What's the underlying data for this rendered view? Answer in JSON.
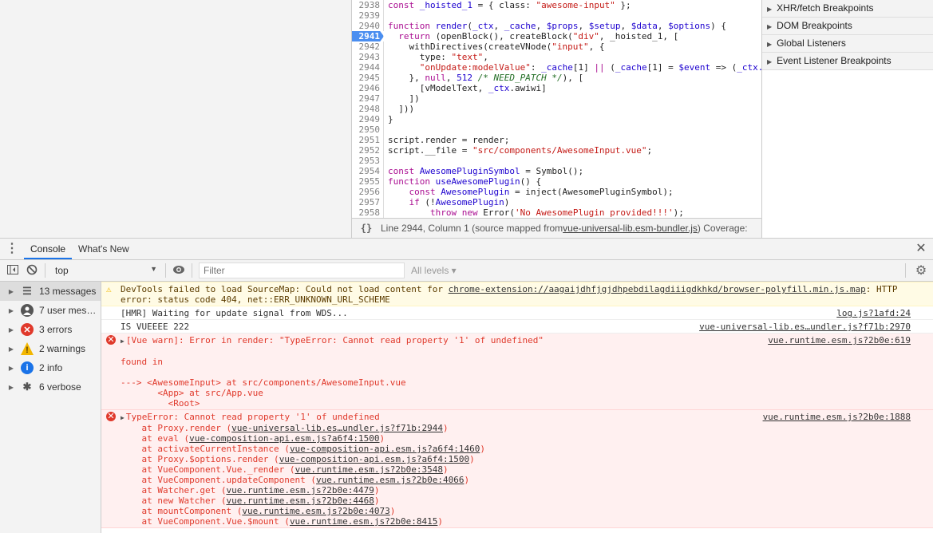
{
  "editor": {
    "active_line": "2941",
    "lines": [
      {
        "n": "2938",
        "t": [
          [
            "const ",
            "kw"
          ],
          [
            "_hoisted_1",
            "id"
          ],
          [
            " = { class: ",
            "pl"
          ],
          [
            "\"awesome-input\"",
            "st"
          ],
          [
            " };",
            "pl"
          ]
        ]
      },
      {
        "n": "2939",
        "t": []
      },
      {
        "n": "2940",
        "t": [
          [
            "function ",
            "kw"
          ],
          [
            "render",
            "id"
          ],
          [
            "(",
            "pl"
          ],
          [
            "_ctx",
            "id"
          ],
          [
            ", ",
            "pl"
          ],
          [
            "_cache",
            "id"
          ],
          [
            ", ",
            "pl"
          ],
          [
            "$props",
            "id"
          ],
          [
            ", ",
            "pl"
          ],
          [
            "$setup",
            "id"
          ],
          [
            ", ",
            "pl"
          ],
          [
            "$data",
            "id"
          ],
          [
            ", ",
            "pl"
          ],
          [
            "$options",
            "id"
          ],
          [
            ") {",
            "pl"
          ]
        ]
      },
      {
        "n": "2941",
        "t": [
          [
            "  return ",
            "kw"
          ],
          [
            "(openBlock(), createBlock(",
            "pl"
          ],
          [
            "\"div\"",
            "st"
          ],
          [
            ", _hoisted_1, [",
            "pl"
          ]
        ]
      },
      {
        "n": "2942",
        "t": [
          [
            "    withDirectives(createVNode(",
            "pl"
          ],
          [
            "\"input\"",
            "st"
          ],
          [
            ", {",
            "pl"
          ]
        ]
      },
      {
        "n": "2943",
        "t": [
          [
            "      type: ",
            "pl"
          ],
          [
            "\"text\"",
            "st"
          ],
          [
            ",",
            "pl"
          ]
        ]
      },
      {
        "n": "2944",
        "t": [
          [
            "      ",
            "pl"
          ],
          [
            "\"onUpdate:modelValue\"",
            "st"
          ],
          [
            ": ",
            "pl"
          ],
          [
            "_cache",
            "id"
          ],
          [
            "[1] ",
            "pl"
          ],
          [
            "||",
            "kw"
          ],
          [
            " (",
            "pl"
          ],
          [
            "_cache",
            "id"
          ],
          [
            "[1] = ",
            "pl"
          ],
          [
            "$event",
            "id"
          ],
          [
            " => (",
            "pl"
          ],
          [
            "_ctx.",
            "id"
          ]
        ]
      },
      {
        "n": "2945",
        "t": [
          [
            "    }, ",
            "pl"
          ],
          [
            "null",
            "kw"
          ],
          [
            ", ",
            "pl"
          ],
          [
            "512",
            "nm"
          ],
          [
            " /* NEED_PATCH */",
            "cm"
          ],
          [
            "), [",
            "pl"
          ]
        ]
      },
      {
        "n": "2946",
        "t": [
          [
            "      [vModelText, ",
            "pl"
          ],
          [
            "_ctx",
            "id"
          ],
          [
            ".awiwi]",
            "pl"
          ]
        ]
      },
      {
        "n": "2947",
        "t": [
          [
            "    ])",
            "pl"
          ]
        ]
      },
      {
        "n": "2948",
        "t": [
          [
            "  ]))",
            "pl"
          ]
        ]
      },
      {
        "n": "2949",
        "t": [
          [
            "}",
            "pl"
          ]
        ]
      },
      {
        "n": "2950",
        "t": []
      },
      {
        "n": "2951",
        "t": [
          [
            "script.render = render;",
            "pl"
          ]
        ]
      },
      {
        "n": "2952",
        "t": [
          [
            "script.__file = ",
            "pl"
          ],
          [
            "\"src/components/AwesomeInput.vue\"",
            "st"
          ],
          [
            ";",
            "pl"
          ]
        ]
      },
      {
        "n": "2953",
        "t": []
      },
      {
        "n": "2954",
        "t": [
          [
            "const ",
            "kw"
          ],
          [
            "AwesomePluginSymbol",
            "id"
          ],
          [
            " = Symbol();",
            "pl"
          ]
        ]
      },
      {
        "n": "2955",
        "t": [
          [
            "function ",
            "kw"
          ],
          [
            "useAwesomePlugin",
            "id"
          ],
          [
            "() {",
            "pl"
          ]
        ]
      },
      {
        "n": "2956",
        "t": [
          [
            "    const ",
            "kw"
          ],
          [
            "AwesomePlugin",
            "id"
          ],
          [
            " = inject(AwesomePluginSymbol);",
            "pl"
          ]
        ]
      },
      {
        "n": "2957",
        "t": [
          [
            "    if ",
            "kw"
          ],
          [
            "(!",
            "pl"
          ],
          [
            "AwesomePlugin",
            "id"
          ],
          [
            ")",
            "pl"
          ]
        ]
      },
      {
        "n": "2958",
        "t": [
          [
            "        throw new ",
            "kw"
          ],
          [
            "Error(",
            "pl"
          ],
          [
            "'No AwesomePlugin provided!!!'",
            "st"
          ],
          [
            ");",
            "pl"
          ]
        ]
      }
    ]
  },
  "statusbar": {
    "format_icon": "{}",
    "position": "Line 2944, Column 1",
    "mapped_prefix": "(source mapped from ",
    "mapped_file": "vue-universal-lib.esm-bundler.js",
    "mapped_suffix": ")",
    "coverage": "Coverage:"
  },
  "breakpoints": [
    "XHR/fetch Breakpoints",
    "DOM Breakpoints",
    "Global Listeners",
    "Event Listener Breakpoints"
  ],
  "drawer": {
    "tabs": [
      "Console",
      "What's New"
    ],
    "active_tab": "Console"
  },
  "toolbar": {
    "context": "top",
    "filter_placeholder": "Filter",
    "levels": "All levels ▾"
  },
  "sidebar": [
    {
      "label": "13 messages",
      "icon": "list-icon",
      "color": "#555"
    },
    {
      "label": "7 user mes…",
      "icon": "user-icon",
      "color": "#555"
    },
    {
      "label": "3 errors",
      "icon": "error-icon",
      "color": "#e0392b"
    },
    {
      "label": "2 warnings",
      "icon": "warning-icon",
      "color": "#f2b600"
    },
    {
      "label": "2 info",
      "icon": "info-icon",
      "color": "#1a73e8"
    },
    {
      "label": "6 verbose",
      "icon": "bug-icon",
      "color": "#555"
    }
  ],
  "messages": {
    "warning": {
      "prefix": "DevTools failed to load SourceMap: Could not load content for ",
      "link": "chrome-extension://aagaijdhfjgjdhpebdilagdiiigdkhkd/browser-polyfill.min.js.map",
      "suffix": ": HTTP error: status code 404, net::ERR_UNKNOWN_URL_SCHEME"
    },
    "hmr": {
      "text": "[HMR] Waiting for update signal from WDS...",
      "source": "log.js?1afd:24"
    },
    "vue": {
      "text": "IS VUEEEE 222",
      "source": "vue-universal-lib.es…undler.js?f71b:2970"
    },
    "vue_warn": {
      "text": "[Vue warn]: Error in render: \"TypeError: Cannot read property '1' of undefined\"",
      "source": "vue.runtime.esm.js?2b0e:619",
      "body": "\nfound in\n\n---> <AwesomeInput> at src/components/AwesomeInput.vue\n       <App> at src/App.vue\n         <Root>"
    },
    "type_error": {
      "text": "TypeError: Cannot read property '1' of undefined",
      "source": "vue.runtime.esm.js?2b0e:1888",
      "stack": [
        [
          "Proxy.render",
          "vue-universal-lib.es…undler.js?f71b:2944"
        ],
        [
          "eval",
          "vue-composition-api.esm.js?a6f4:1500"
        ],
        [
          "activateCurrentInstance",
          "vue-composition-api.esm.js?a6f4:1460"
        ],
        [
          "Proxy.$options.render",
          "vue-composition-api.esm.js?a6f4:1500"
        ],
        [
          "VueComponent.Vue._render",
          "vue.runtime.esm.js?2b0e:3548"
        ],
        [
          "VueComponent.updateComponent",
          "vue.runtime.esm.js?2b0e:4066"
        ],
        [
          "Watcher.get",
          "vue.runtime.esm.js?2b0e:4479"
        ],
        [
          "new Watcher",
          "vue.runtime.esm.js?2b0e:4468"
        ],
        [
          "mountComponent",
          "vue.runtime.esm.js?2b0e:4073"
        ],
        [
          "VueComponent.Vue.$mount",
          "vue.runtime.esm.js?2b0e:8415"
        ]
      ]
    }
  }
}
